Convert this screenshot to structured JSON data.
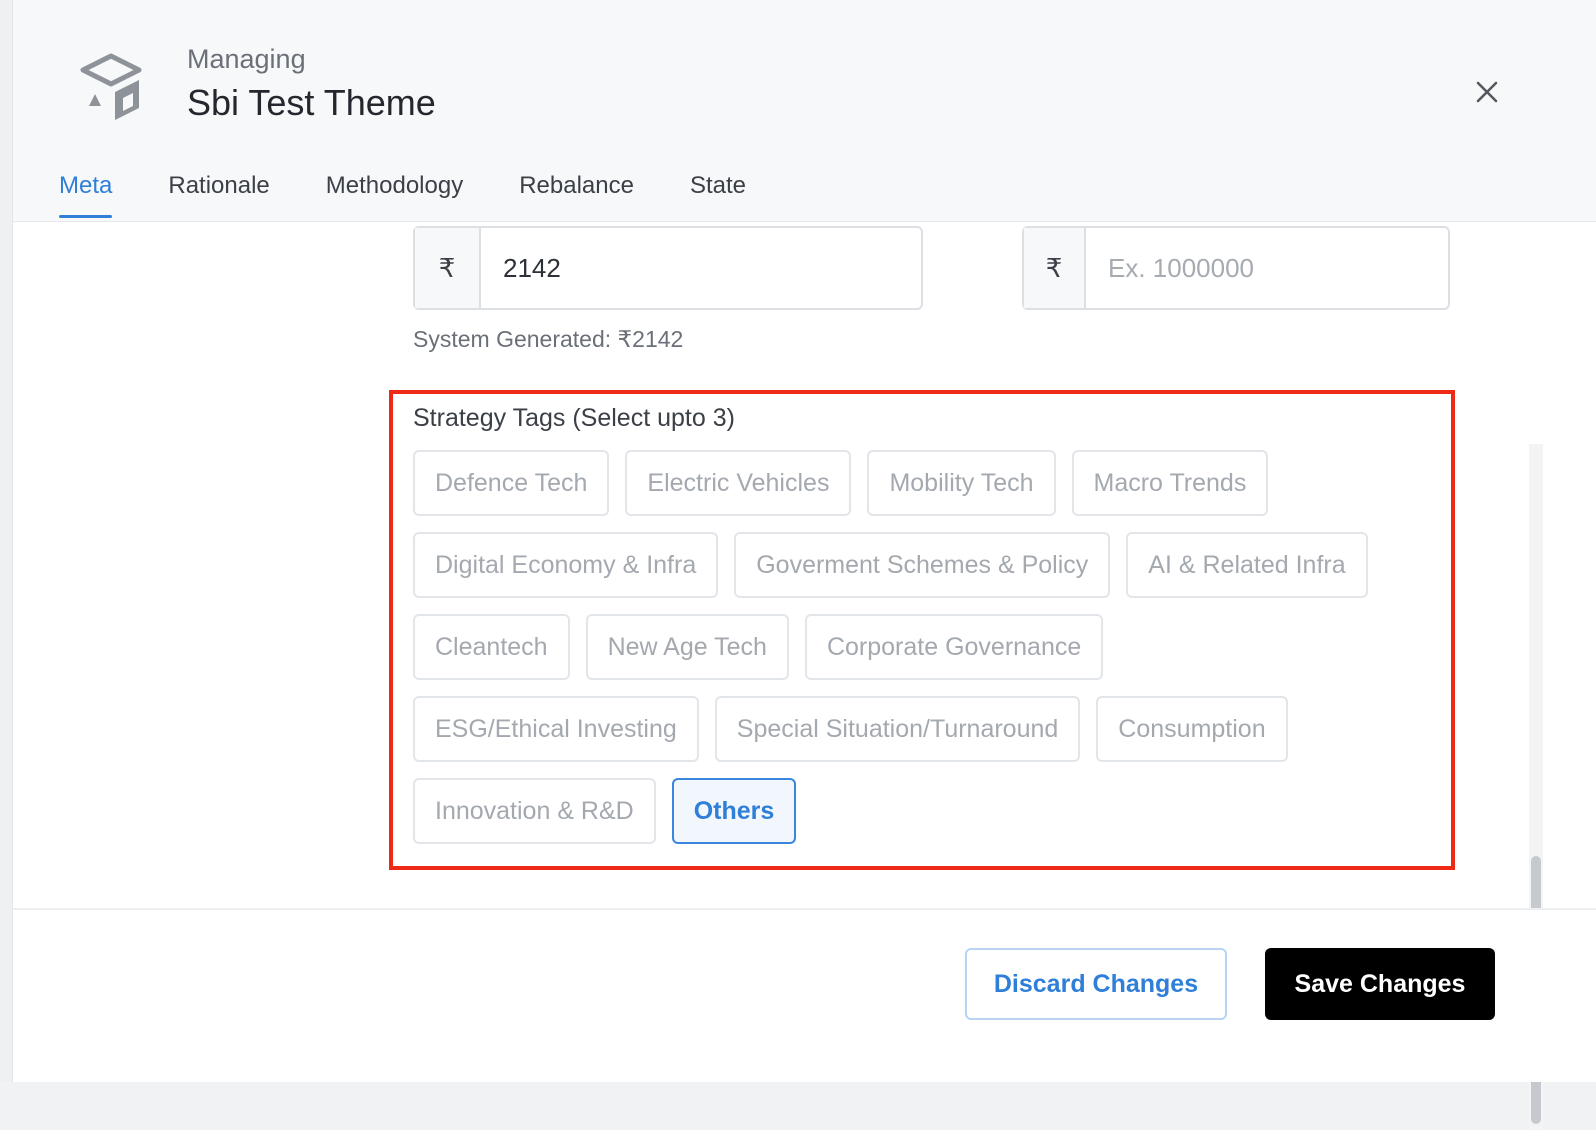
{
  "header": {
    "managing_label": "Managing",
    "theme_title": "Sbi Test Theme"
  },
  "tabs": [
    {
      "label": "Meta",
      "active": true
    },
    {
      "label": "Rationale",
      "active": false
    },
    {
      "label": "Methodology",
      "active": false
    },
    {
      "label": "Rebalance",
      "active": false
    },
    {
      "label": "State",
      "active": false
    }
  ],
  "form": {
    "currency_symbol": "₹",
    "min_investment_value": "2142",
    "max_investment_placeholder": "Ex. 1000000",
    "helper_text": "System Generated: ₹2142"
  },
  "strategy_tags": {
    "label": "Strategy Tags (Select upto 3)",
    "rows": [
      [
        "Defence Tech",
        "Electric Vehicles",
        "Mobility Tech",
        "Macro Trends"
      ],
      [
        "Digital Economy & Infra",
        "Goverment Schemes & Policy",
        "AI & Related Infra"
      ],
      [
        "Cleantech",
        "New Age Tech",
        "Corporate Governance"
      ],
      [
        "ESG/Ethical Investing",
        "Special Situation/Turnaround",
        "Consumption"
      ],
      [
        "Innovation & R&D",
        "Others"
      ]
    ],
    "selected": [
      "Others"
    ]
  },
  "footer": {
    "discard_label": "Discard Changes",
    "save_label": "Save Changes"
  },
  "colors": {
    "accent": "#2f7fd8",
    "highlight_border": "#ee2a16",
    "primary_button": "#000000"
  },
  "icons": {
    "logo": "cube-logo-icon",
    "close": "close-icon"
  }
}
